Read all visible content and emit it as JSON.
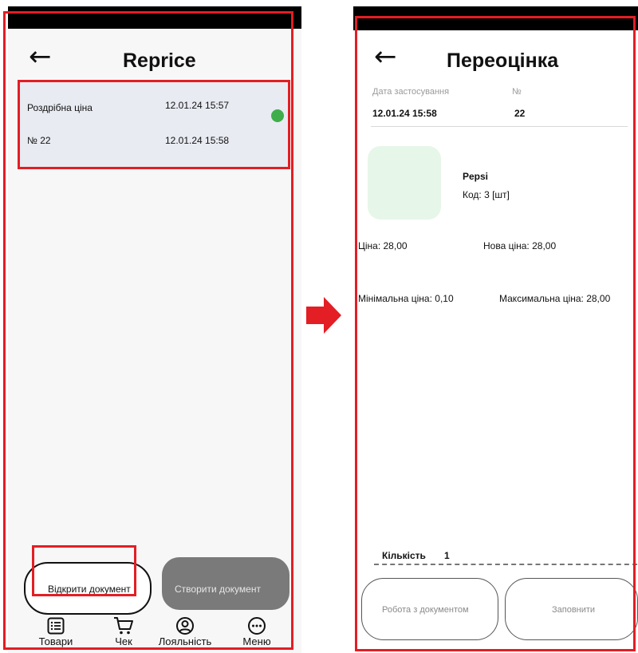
{
  "left_screen": {
    "title": "Reprice",
    "document_card": {
      "type_label": "Роздрібна ціна",
      "created_at": "12.01.24 15:57",
      "number_label": "№ 22",
      "number_date": "12.01.24 15:58",
      "status_color": "#3fae4a"
    },
    "open_document_label": "Відкрити документ",
    "create_document_label": "Створити документ",
    "bottom_nav": [
      {
        "label": "Товари",
        "icon": "list-icon"
      },
      {
        "label": "Чек",
        "icon": "cart-icon"
      },
      {
        "label": "Лояльність",
        "icon": "user-circle-icon"
      },
      {
        "label": "Меню",
        "icon": "more-dots-icon"
      }
    ]
  },
  "right_screen": {
    "title": "Переоцінка",
    "application_date_label": "Дата застосування",
    "number_label": "№",
    "application_date": "12.01.24 15:58",
    "number": "22",
    "product": {
      "name": "Pepsi",
      "code": "Код: 3 [шт]"
    },
    "price": "Ціна: 28,00",
    "new_price": "Нова ціна: 28,00",
    "min_price": "Мінімальна ціна: 0,10",
    "max_price": "Максимальна ціна: 28,00",
    "quantity_label": "Кількість",
    "quantity_value": "1",
    "work_with_document_label": "Робота з документом",
    "fill_label": "Заповнити"
  },
  "colors": {
    "highlight": "#e31e24",
    "status_green": "#3fae4a",
    "disabled_button": "#7a7a7a"
  }
}
